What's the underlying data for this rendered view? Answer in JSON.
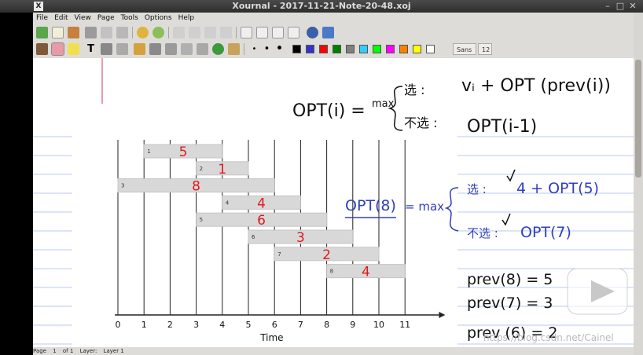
{
  "window": {
    "title": "Xournal - 2017-11-21-Note-20-48.xoj"
  },
  "menu": [
    "File",
    "Edit",
    "View",
    "Page",
    "Tools",
    "Options",
    "Help"
  ],
  "font": {
    "name": "Sans",
    "size": "12"
  },
  "colors": {
    "black": "#000000",
    "blue": "#3333cc",
    "red": "#ff0000",
    "green": "#008000",
    "gray": "#808080",
    "cyan": "#33ccff",
    "lime": "#00ff00",
    "magenta": "#ff00ff",
    "orange": "#ff8000",
    "yellow": "#ffff00",
    "white": "#ffffff"
  },
  "notes": {
    "formula": {
      "lhs": "OPT(i) =",
      "max": "max",
      "choose_label": "选 :",
      "choose_value": "vᵢ + OPT (prev(i))",
      "skip_label": "不选 :",
      "skip_value": "OPT(i-1)"
    },
    "opt8": {
      "lhs": "OPT(8)",
      "eq": "= max",
      "choose_label": "选 :",
      "choose_value": "4 + OPT(5)",
      "skip_label": "不选 :",
      "skip_value": "OPT(7)"
    },
    "prev": [
      "prev(8) = 5",
      "prev(7) = 3",
      "prev (6) = 2"
    ]
  },
  "chart_data": {
    "type": "bar",
    "xlabel": "Time",
    "x_ticks": [
      0,
      1,
      2,
      3,
      4,
      5,
      6,
      7,
      8,
      9,
      10,
      11
    ],
    "jobs": [
      {
        "id": "1",
        "start": 1,
        "end": 4,
        "value": "5"
      },
      {
        "id": "2",
        "start": 3,
        "end": 5,
        "value": "1"
      },
      {
        "id": "3",
        "start": 0,
        "end": 6,
        "value": "8"
      },
      {
        "id": "4",
        "start": 4,
        "end": 7,
        "value": "4"
      },
      {
        "id": "5",
        "start": 3,
        "end": 8,
        "value": "6"
      },
      {
        "id": "6",
        "start": 5,
        "end": 9,
        "value": "3"
      },
      {
        "id": "7",
        "start": 6,
        "end": 10,
        "value": "2"
      },
      {
        "id": "8",
        "start": 8,
        "end": 11,
        "value": "4"
      }
    ]
  },
  "status": {
    "page_label": "Page",
    "page_value": "1",
    "of_pages": "of 1",
    "layer_label": "Layer:",
    "layer_value": "Layer 1"
  },
  "watermark": "https://blog.csdn.net/Cainel"
}
